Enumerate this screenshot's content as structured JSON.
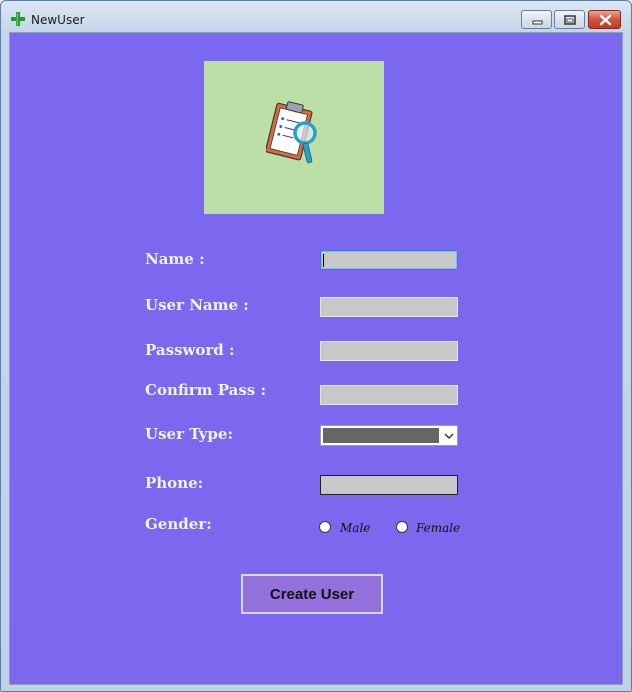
{
  "window": {
    "title": "NewUser",
    "icon": "green-plus-icon"
  },
  "form": {
    "name_label": "Name :",
    "username_label": "User Name :",
    "password_label": "Password :",
    "confirm_label": "Confirm Pass :",
    "usertype_label": "User Type:",
    "phone_label": "Phone:",
    "gender_label": "Gender:",
    "gender_options": [
      "Male",
      "Female"
    ],
    "create_button": "Create User",
    "logo_icon": "clipboard-search-icon"
  },
  "colors": {
    "background": "#7b68ee",
    "logo_background": "#bcdfa8",
    "input_background": "#c8c8c8",
    "button_background": "#9370db"
  }
}
